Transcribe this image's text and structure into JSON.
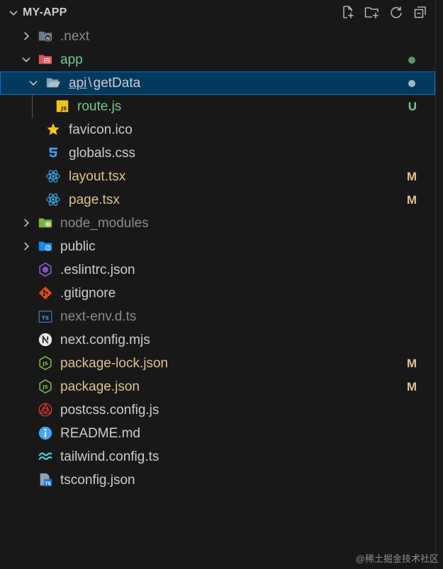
{
  "header": {
    "title": "MY-APP",
    "actions": [
      "new-file-icon",
      "new-folder-icon",
      "refresh-icon",
      "collapse-all-icon"
    ]
  },
  "tree": [
    {
      "label": ".next",
      "kind": "folder",
      "expanded": false,
      "color": "dim"
    },
    {
      "label": "app",
      "kind": "folder",
      "expanded": true,
      "color": "green",
      "decoration": "dot"
    },
    {
      "label_parts": [
        "api",
        "\\",
        "getData"
      ],
      "kind": "folder",
      "expanded": true,
      "color": "normal",
      "decoration": "dot",
      "selected": true
    },
    {
      "label": "route.js",
      "kind": "file",
      "icon": "js-icon",
      "color": "green",
      "badge": "U"
    },
    {
      "label": "favicon.ico",
      "kind": "file",
      "icon": "star-icon",
      "color": "normal"
    },
    {
      "label": "globals.css",
      "kind": "file",
      "icon": "css-icon",
      "color": "normal"
    },
    {
      "label": "layout.tsx",
      "kind": "file",
      "icon": "react-icon",
      "color": "modified",
      "badge": "M"
    },
    {
      "label": "page.tsx",
      "kind": "file",
      "icon": "react-icon",
      "color": "modified",
      "badge": "M"
    },
    {
      "label": "node_modules",
      "kind": "folder",
      "expanded": false,
      "color": "dim"
    },
    {
      "label": "public",
      "kind": "folder",
      "expanded": false,
      "color": "normal"
    },
    {
      "label": ".eslintrc.json",
      "kind": "file",
      "icon": "eslint-icon",
      "color": "normal"
    },
    {
      "label": ".gitignore",
      "kind": "file",
      "icon": "git-icon",
      "color": "normal"
    },
    {
      "label": "next-env.d.ts",
      "kind": "file",
      "icon": "typescript-def-icon",
      "color": "dim"
    },
    {
      "label": "next.config.mjs",
      "kind": "file",
      "icon": "nextjs-icon",
      "color": "normal"
    },
    {
      "label": "package-lock.json",
      "kind": "file",
      "icon": "nodejs-icon",
      "color": "modified",
      "badge": "M"
    },
    {
      "label": "package.json",
      "kind": "file",
      "icon": "nodejs-icon",
      "color": "modified",
      "badge": "M"
    },
    {
      "label": "postcss.config.js",
      "kind": "file",
      "icon": "postcss-icon",
      "color": "normal"
    },
    {
      "label": "README.md",
      "kind": "file",
      "icon": "info-icon",
      "color": "normal"
    },
    {
      "label": "tailwind.config.ts",
      "kind": "file",
      "icon": "tailwind-icon",
      "color": "normal"
    },
    {
      "label": "tsconfig.json",
      "kind": "file",
      "icon": "tsconfig-icon",
      "color": "normal"
    }
  ],
  "colors": {
    "background": "#181818",
    "selected_bg": "#04395e",
    "selected_border": "#0078d4",
    "modified": "#e2c08d",
    "untracked": "#73c991",
    "dim": "#8b8b8b",
    "normal": "#cccccc"
  },
  "watermark": "@稀土掘金技术社区"
}
